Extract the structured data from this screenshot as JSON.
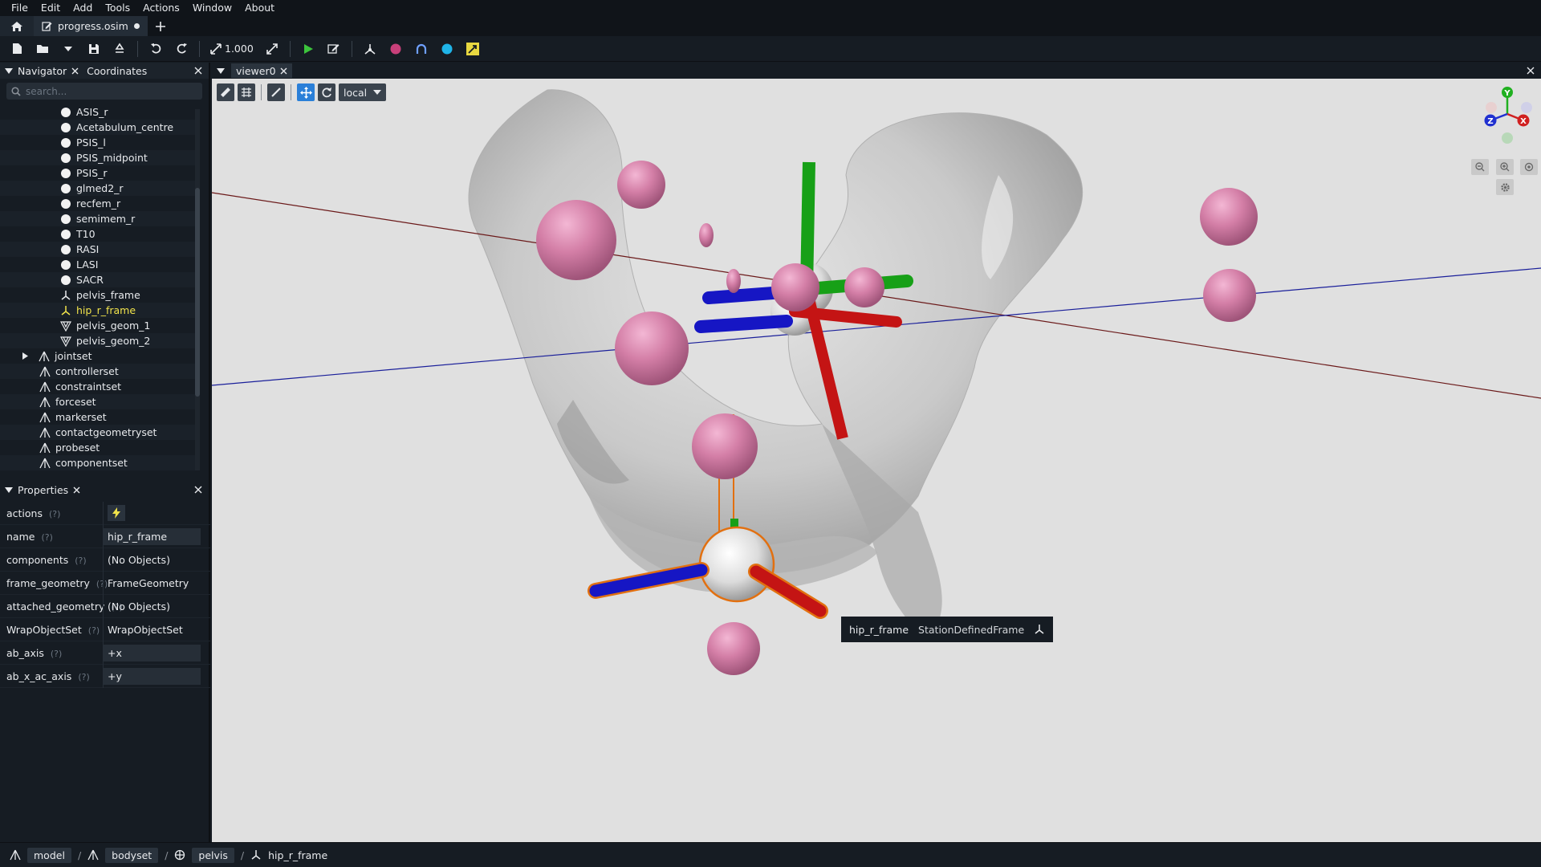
{
  "menubar": {
    "items": [
      "File",
      "Edit",
      "Add",
      "Tools",
      "Actions",
      "Window",
      "About"
    ]
  },
  "tabs": {
    "file_tab": "progress.osim"
  },
  "toolbar": {
    "scale_value": "1.000"
  },
  "navigator": {
    "tab_label": "Navigator",
    "coordinates_label": "Coordinates",
    "search_placeholder": "search...",
    "items": [
      {
        "label": "ASIS_r",
        "icon": "marker-icon"
      },
      {
        "label": "Acetabulum_centre",
        "icon": "marker-icon"
      },
      {
        "label": "PSIS_l",
        "icon": "marker-icon"
      },
      {
        "label": "PSIS_midpoint",
        "icon": "marker-icon"
      },
      {
        "label": "PSIS_r",
        "icon": "marker-icon"
      },
      {
        "label": "glmed2_r",
        "icon": "marker-icon"
      },
      {
        "label": "recfem_r",
        "icon": "marker-icon"
      },
      {
        "label": "semimem_r",
        "icon": "marker-icon"
      },
      {
        "label": "T10",
        "icon": "marker-icon"
      },
      {
        "label": "RASI",
        "icon": "marker-icon"
      },
      {
        "label": "LASI",
        "icon": "marker-icon"
      },
      {
        "label": "SACR",
        "icon": "marker-icon"
      },
      {
        "label": "pelvis_frame",
        "icon": "frame-icon"
      },
      {
        "label": "hip_r_frame",
        "icon": "frame-icon",
        "selected": true
      },
      {
        "label": "pelvis_geom_1",
        "icon": "mesh-icon"
      },
      {
        "label": "pelvis_geom_2",
        "icon": "mesh-icon"
      },
      {
        "label": "jointset",
        "icon": "component-icon",
        "expandable": true
      },
      {
        "label": "controllerset",
        "icon": "component-icon"
      },
      {
        "label": "constraintset",
        "icon": "component-icon"
      },
      {
        "label": "forceset",
        "icon": "component-icon"
      },
      {
        "label": "markerset",
        "icon": "component-icon"
      },
      {
        "label": "contactgeometryset",
        "icon": "component-icon"
      },
      {
        "label": "probeset",
        "icon": "component-icon"
      },
      {
        "label": "componentset",
        "icon": "component-icon"
      }
    ]
  },
  "properties": {
    "title": "Properties",
    "help_marker": "(?)",
    "rows": [
      {
        "name": "actions",
        "value": "",
        "type": "action"
      },
      {
        "name": "name",
        "value": "hip_r_frame",
        "type": "input"
      },
      {
        "name": "components",
        "value": "(No Objects)",
        "type": "text"
      },
      {
        "name": "frame_geometry",
        "value": "FrameGeometry",
        "type": "text"
      },
      {
        "name": "attached_geometry",
        "value": "(No Objects)",
        "type": "text"
      },
      {
        "name": "WrapObjectSet",
        "value": "WrapObjectSet",
        "type": "text"
      },
      {
        "name": "ab_axis",
        "value": "+x",
        "type": "input"
      },
      {
        "name": "ab_x_ac_axis",
        "value": "+y",
        "type": "input"
      }
    ]
  },
  "viewer": {
    "tab_label": "viewer0",
    "space_mode": "local",
    "axes": {
      "x": "X",
      "y": "Y",
      "z": "Z"
    },
    "tooltip": {
      "name": "hip_r_frame",
      "type": "StationDefinedFrame"
    }
  },
  "statusbar": {
    "crumbs": [
      "model",
      "bodyset",
      "pelvis",
      "hip_r_frame"
    ]
  },
  "colors": {
    "accent": "#2a7fd8",
    "selected_text": "#f1e34b",
    "marker": "#d97aa8",
    "x_axis": "#c01414",
    "y_axis": "#14a014",
    "z_axis": "#1414c8"
  }
}
